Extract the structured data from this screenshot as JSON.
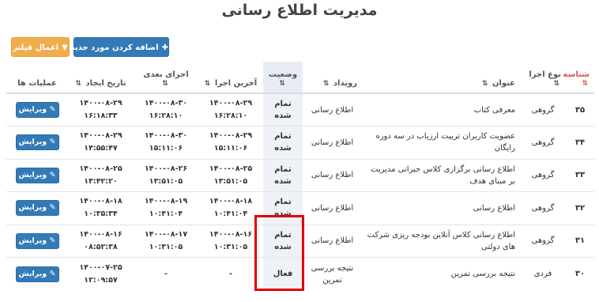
{
  "page": {
    "title": "مدیریت اطلاع رسانی"
  },
  "toolbar": {
    "add_label": "اضافه کردن مورد جدید",
    "add_icon": "plus-icon",
    "filter_label": "اعمال فیلتر",
    "filter_icon": "filter-icon",
    "add_color": "#337ab7",
    "filter_color": "#f0ad4e"
  },
  "table": {
    "headers": {
      "id": "شناسه",
      "run_type": "نوع اجرا",
      "title": "عنوان",
      "event": "رویداد",
      "status": "وضعیت",
      "last_run": "آخرین اجرا",
      "next_run": "اجرای بعدی",
      "created": "تاریخ ایجاد",
      "actions": "عملیات ها"
    },
    "edit_label": "ویرایش",
    "edit_icon": "edit-icon",
    "rows": [
      {
        "id": "۳۵",
        "run_type": "گروهی",
        "title": "معرفی کتاب",
        "event": "اطلاع رسانی",
        "status": "تمام شده",
        "last_run_date": "۱۴۰۰-۰۸-۲۹",
        "last_run_time": "۱۶:۲۸:۱۰",
        "next_run_date": "۱۴۰۰-۰۸-۳۰",
        "next_run_time": "۱۶:۲۸:۱۰",
        "created_date": "۱۴۰۰-۰۸-۲۹",
        "created_time": "۱۶:۱۸:۳۳"
      },
      {
        "id": "۳۴",
        "run_type": "گروهی",
        "title": "عضویت کاربران تربیت ارزیاب در سه دوره رایگان",
        "event": "اطلاع رسانی",
        "status": "تمام شده",
        "last_run_date": "۱۴۰۰-۰۸-۲۹",
        "last_run_time": "۱۵:۱۱:۰۶",
        "next_run_date": "۱۴۰۰-۰۸-۳۰",
        "next_run_time": "۱۵:۱۱:۰۶",
        "created_date": "۱۴۰۰-۰۸-۲۹",
        "created_time": "۱۴:۵۵:۴۷"
      },
      {
        "id": "۳۳",
        "run_type": "گروهی",
        "title": "اطلاع رسانی برگزاری کلاس جبرانی مدیریت بر مبنای هدف",
        "event": "اطلاع رسانی",
        "status": "تمام شده",
        "last_run_date": "۱۴۰۰-۰۸-۲۵",
        "last_run_time": "۱۳:۵۱:۰۵",
        "next_run_date": "۱۴۰۰-۰۸-۲۶",
        "next_run_time": "۱۳:۵۱:۰۵",
        "created_date": "۱۴۰۰-۰۸-۲۵",
        "created_time": "۱۳:۴۲:۲۰"
      },
      {
        "id": "۳۲",
        "run_type": "گروهی",
        "title": "اطلاع رسانی",
        "event": "اطلاع رسانی",
        "status": "تمام شده",
        "last_run_date": "۱۴۰۰-۰۸-۱۸",
        "last_run_time": "۱۰:۴۱:۰۴",
        "next_run_date": "۱۴۰۰-۰۸-۱۹",
        "next_run_time": "۱۰:۴۱:۰۴",
        "created_date": "۱۴۰۰-۰۸-۱۸",
        "created_time": "۱۰:۳۵:۳۴"
      },
      {
        "id": "۳۱",
        "run_type": "گروهی",
        "title": "اطلاع رسانی کلاس آنلاین بودجه ریزی شرکت های دولتی",
        "event": "اطلاع رسانی",
        "status": "تمام شده",
        "last_run_date": "۱۴۰۰-۰۸-۱۶",
        "last_run_time": "۱۰:۳۱:۰۵",
        "next_run_date": "۱۴۰۰-۰۸-۱۷",
        "next_run_time": "۱۰:۳۱:۰۵",
        "created_date": "۱۴۰۰-۰۸-۱۶",
        "created_time": "۰۸:۵۲:۳۸"
      },
      {
        "id": "۳۰",
        "run_type": "فردی",
        "title": "نتیجه بررسی تمرین",
        "event": "نتیجه بررسی تمرین",
        "status": "فعال",
        "last_run_date": "-",
        "last_run_time": "",
        "next_run_date": "-",
        "next_run_time": "",
        "created_date": "۱۴۰۰-۰۷-۲۵",
        "created_time": "۱۲:۰۹:۵۷"
      }
    ]
  },
  "annotation": {
    "highlight_color": "#e00000"
  }
}
